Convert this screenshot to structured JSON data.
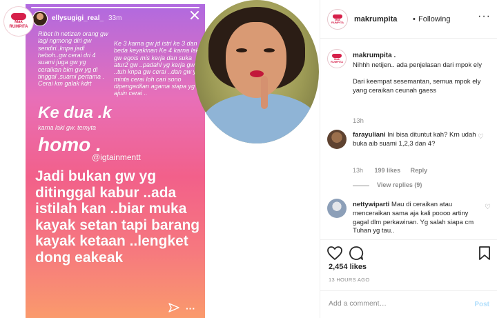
{
  "story": {
    "username": "ellysugigi_real_",
    "time": "33m",
    "text_1": "Ribet ih netizen orang gw lagi ngmong diri gw sendiri..knpa jadi heboh..gw cerai dri 4 suami juga gw yg ceraikan bkn gw yg di tinggal .suami pertama . Cerai km galak kdrt",
    "text_2": "Ke 3 karna gw jd istri ke 3 dan beda keyakinan Ke 4 karna laki gw egois mis kerja dan suka atur2 gw ..padahl yg kerja gw ..tuh knpa gw cerai ..dan gw yg minta cerai loh cari sono dipengadilan agama siapa yg ajuin cerai ..",
    "text_3": "Ke dua .k",
    "text_4": "karna laki gw. temyta",
    "text_5": "homo .",
    "watermark": "@igtainmentt",
    "text_6": "Jadi bukan gw yg ditinggal kabur ..ada istilah kan ..biar muka kayak setan tapi barang kayak ketaan ..lengket dong eakeak",
    "more": "···"
  },
  "logo": {
    "line1": "Mak",
    "line2": "RUMPITA"
  },
  "header": {
    "username": "makrumpita",
    "dot": "•",
    "follow_label": "Following",
    "more": "···"
  },
  "caption": {
    "username": "makrumpita .",
    "para1": "Nihhh netijen.. ada penjelasan dari mpok ely",
    "para2": "Dari keempat sesemantan, semua mpok ely yang ceraikan ceunah gaess",
    "time": "13h"
  },
  "comments": [
    {
      "username": "farayuliani",
      "text": " Ini bisa dituntut kah? Krn udah buka aib suami 1,2,3 dan 4?",
      "time": "13h",
      "likes": "199 likes",
      "reply": "Reply",
      "view_replies": "View replies (9)"
    },
    {
      "username": "nettywiparti",
      "text": " Mau di ceraikan atau menceraikan sama aja kali poooo artiny gagal dlm perkawinan. Yg salah siapa cm Tuhan yg tau.."
    }
  ],
  "actions": {
    "likes": "2,454 likes",
    "time": "13 HOURS AGO"
  },
  "add_comment": {
    "placeholder": "Add a comment…",
    "post_label": "Post"
  }
}
